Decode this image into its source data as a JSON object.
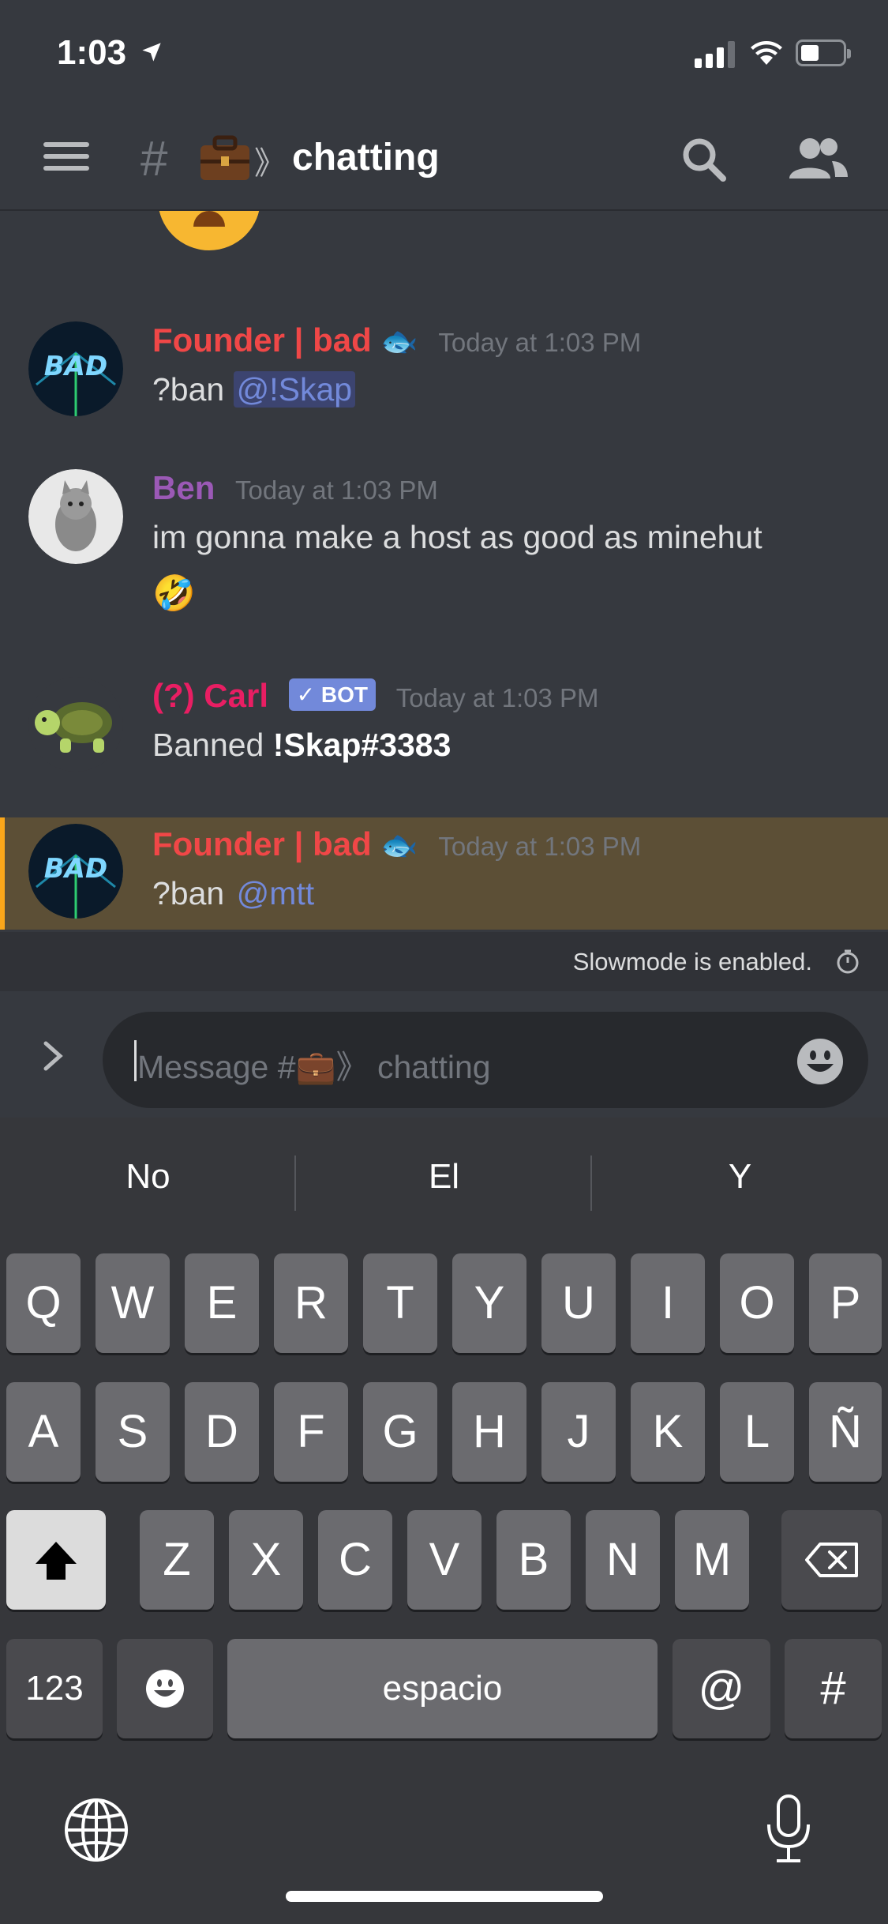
{
  "status_bar": {
    "time": "1:03"
  },
  "header": {
    "channel_hash": "#",
    "channel_emoji": "💼》",
    "channel_name": "chatting"
  },
  "messages": [
    {
      "author": "Founder | bad",
      "author_emoji": "🐟",
      "author_color": "#f04747",
      "timestamp": "Today at 1:03 PM",
      "text": "?ban ",
      "mention": "@!Skap"
    },
    {
      "author": "Ben",
      "author_color": "#9b59b6",
      "timestamp": "Today at 1:03 PM",
      "text": "im gonna make a host as good as minehut",
      "emoji": "🤣"
    },
    {
      "author": "(?) Carl",
      "author_color": "#e91e63",
      "bot_tag": "✓ BOT",
      "timestamp": "Today at 1:03 PM",
      "text": "Banned ",
      "bold": "!Skap#3383"
    },
    {
      "author": "Founder | bad",
      "author_emoji": "🐟",
      "author_color": "#f04747",
      "timestamp": "Today at 1:03 PM",
      "text": "?ban ",
      "mention": "@mtt"
    }
  ],
  "slowmode": {
    "text": "Slowmode is enabled."
  },
  "composer": {
    "placeholder": "Message #💼》 chatting"
  },
  "keyboard": {
    "suggestions": [
      "No",
      "El",
      "Y"
    ],
    "row1": [
      "Q",
      "W",
      "E",
      "R",
      "T",
      "Y",
      "U",
      "I",
      "O",
      "P"
    ],
    "row2": [
      "A",
      "S",
      "D",
      "F",
      "G",
      "H",
      "J",
      "K",
      "L",
      "Ñ"
    ],
    "row3": [
      "Z",
      "X",
      "C",
      "V",
      "B",
      "N",
      "M"
    ],
    "numbers_key": "123",
    "space_key": "espacio",
    "at_key": "@",
    "hash_key": "#"
  }
}
